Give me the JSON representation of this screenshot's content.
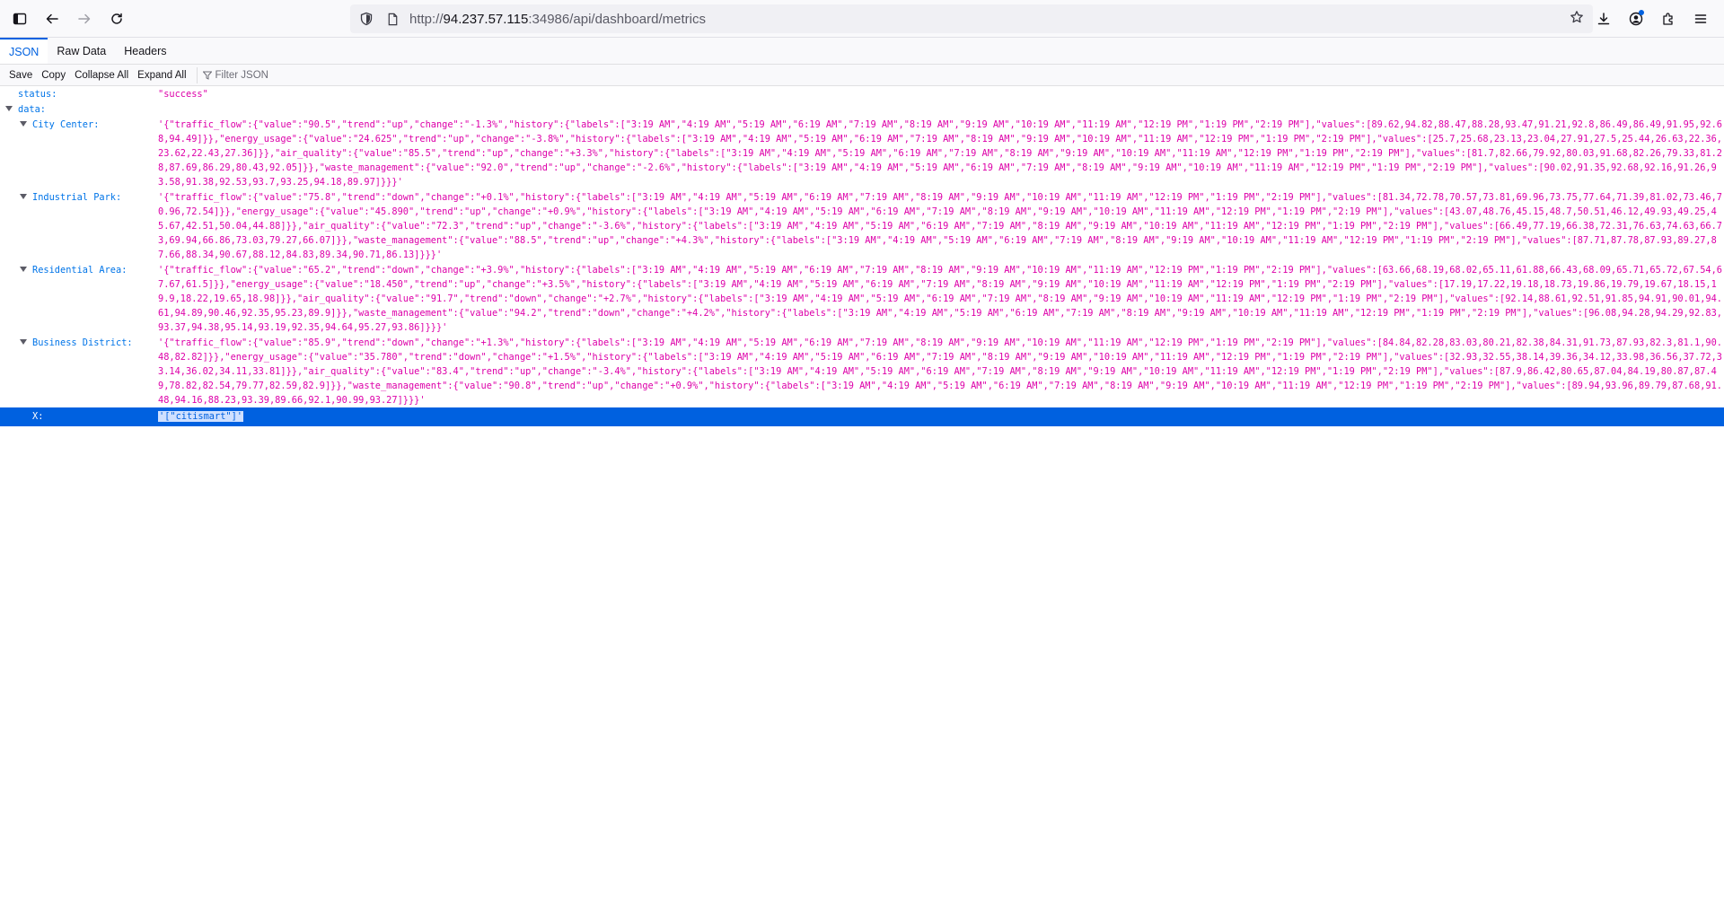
{
  "browser": {
    "url_scheme": "http://",
    "url_host": "94.237.57.115",
    "url_path": ":34986/api/dashboard/metrics"
  },
  "viewer": {
    "tabs": [
      "JSON",
      "Raw Data",
      "Headers"
    ],
    "actions": [
      "Save",
      "Copy",
      "Collapse All",
      "Expand All"
    ],
    "filter_placeholder": "Filter JSON"
  },
  "tree": {
    "status_key": "status:",
    "status_val": "\"success\"",
    "data_key": "data:",
    "entries": [
      {
        "key": "City Center:",
        "value": "'{\"traffic_flow\":{\"value\":\"90.5\",\"trend\":\"up\",\"change\":\"-1.3%\",\"history\":{\"labels\":[\"3:19 AM\",\"4:19 AM\",\"5:19 AM\",\"6:19 AM\",\"7:19 AM\",\"8:19 AM\",\"9:19 AM\",\"10:19 AM\",\"11:19 AM\",\"12:19 PM\",\"1:19 PM\",\"2:19 PM\"],\"values\":[89.62,94.82,88.47,88.28,93.47,91.21,92.8,86.49,86.49,91.95,92.68,94.49]}},\"energy_usage\":{\"value\":\"24.625\",\"trend\":\"up\",\"change\":\"-3.8%\",\"history\":{\"labels\":[\"3:19 AM\",\"4:19 AM\",\"5:19 AM\",\"6:19 AM\",\"7:19 AM\",\"8:19 AM\",\"9:19 AM\",\"10:19 AM\",\"11:19 AM\",\"12:19 PM\",\"1:19 PM\",\"2:19 PM\"],\"values\":[25.7,25.68,23.13,23.04,27.91,27.5,25.44,26.63,22.36,23.62,22.43,27.36]}},\"air_quality\":{\"value\":\"85.5\",\"trend\":\"up\",\"change\":\"+3.3%\",\"history\":{\"labels\":[\"3:19 AM\",\"4:19 AM\",\"5:19 AM\",\"6:19 AM\",\"7:19 AM\",\"8:19 AM\",\"9:19 AM\",\"10:19 AM\",\"11:19 AM\",\"12:19 PM\",\"1:19 PM\",\"2:19 PM\"],\"values\":[81.7,82.66,79.92,80.03,91.68,82.26,79.33,81.28,87.69,86.29,80.43,92.05]}},\"waste_management\":{\"value\":\"92.0\",\"trend\":\"up\",\"change\":\"-2.6%\",\"history\":{\"labels\":[\"3:19 AM\",\"4:19 AM\",\"5:19 AM\",\"6:19 AM\",\"7:19 AM\",\"8:19 AM\",\"9:19 AM\",\"10:19 AM\",\"11:19 AM\",\"12:19 PM\",\"1:19 PM\",\"2:19 PM\"],\"values\":[90.02,91.35,92.68,92.16,91.26,93.58,91.38,92.53,93.7,93.25,94.18,89.97]}}}'"
      },
      {
        "key": "Industrial Park:",
        "value": "'{\"traffic_flow\":{\"value\":\"75.8\",\"trend\":\"down\",\"change\":\"+0.1%\",\"history\":{\"labels\":[\"3:19 AM\",\"4:19 AM\",\"5:19 AM\",\"6:19 AM\",\"7:19 AM\",\"8:19 AM\",\"9:19 AM\",\"10:19 AM\",\"11:19 AM\",\"12:19 PM\",\"1:19 PM\",\"2:19 PM\"],\"values\":[81.34,72.78,70.57,73.81,69.96,73.75,77.64,71.39,81.02,73.46,70.96,72.54]}},\"energy_usage\":{\"value\":\"45.890\",\"trend\":\"up\",\"change\":\"+0.9%\",\"history\":{\"labels\":[\"3:19 AM\",\"4:19 AM\",\"5:19 AM\",\"6:19 AM\",\"7:19 AM\",\"8:19 AM\",\"9:19 AM\",\"10:19 AM\",\"11:19 AM\",\"12:19 PM\",\"1:19 PM\",\"2:19 PM\"],\"values\":[43.07,48.76,45.15,48.7,50.51,46.12,49.93,49.25,45.67,42.51,50.04,44.88]}},\"air_quality\":{\"value\":\"72.3\",\"trend\":\"up\",\"change\":\"-3.6%\",\"history\":{\"labels\":[\"3:19 AM\",\"4:19 AM\",\"5:19 AM\",\"6:19 AM\",\"7:19 AM\",\"8:19 AM\",\"9:19 AM\",\"10:19 AM\",\"11:19 AM\",\"12:19 PM\",\"1:19 PM\",\"2:19 PM\"],\"values\":[66.49,77.19,66.38,72.31,76.63,74.63,66.73,69.94,66.86,73.03,79.27,66.07]}},\"waste_management\":{\"value\":\"88.5\",\"trend\":\"up\",\"change\":\"+4.3%\",\"history\":{\"labels\":[\"3:19 AM\",\"4:19 AM\",\"5:19 AM\",\"6:19 AM\",\"7:19 AM\",\"8:19 AM\",\"9:19 AM\",\"10:19 AM\",\"11:19 AM\",\"12:19 PM\",\"1:19 PM\",\"2:19 PM\"],\"values\":[87.71,87.78,87.93,89.27,87.66,88.34,90.67,88.12,84.83,89.34,90.71,86.13]}}}'"
      },
      {
        "key": "Residential Area:",
        "value": "'{\"traffic_flow\":{\"value\":\"65.2\",\"trend\":\"down\",\"change\":\"+3.9%\",\"history\":{\"labels\":[\"3:19 AM\",\"4:19 AM\",\"5:19 AM\",\"6:19 AM\",\"7:19 AM\",\"8:19 AM\",\"9:19 AM\",\"10:19 AM\",\"11:19 AM\",\"12:19 PM\",\"1:19 PM\",\"2:19 PM\"],\"values\":[63.66,68.19,68.02,65.11,61.88,66.43,68.09,65.71,65.72,67.54,67.67,61.5]}},\"energy_usage\":{\"value\":\"18.450\",\"trend\":\"up\",\"change\":\"+3.5%\",\"history\":{\"labels\":[\"3:19 AM\",\"4:19 AM\",\"5:19 AM\",\"6:19 AM\",\"7:19 AM\",\"8:19 AM\",\"9:19 AM\",\"10:19 AM\",\"11:19 AM\",\"12:19 PM\",\"1:19 PM\",\"2:19 PM\"],\"values\":[17.19,17.22,19.18,18.73,19.86,19.79,19.67,18.15,19.9,18.22,19.65,18.98]}},\"air_quality\":{\"value\":\"91.7\",\"trend\":\"down\",\"change\":\"+2.7%\",\"history\":{\"labels\":[\"3:19 AM\",\"4:19 AM\",\"5:19 AM\",\"6:19 AM\",\"7:19 AM\",\"8:19 AM\",\"9:19 AM\",\"10:19 AM\",\"11:19 AM\",\"12:19 PM\",\"1:19 PM\",\"2:19 PM\"],\"values\":[92.14,88.61,92.51,91.85,94.91,90.01,94.61,94.89,90.46,92.35,95.23,89.9]}},\"waste_management\":{\"value\":\"94.2\",\"trend\":\"down\",\"change\":\"+4.2%\",\"history\":{\"labels\":[\"3:19 AM\",\"4:19 AM\",\"5:19 AM\",\"6:19 AM\",\"7:19 AM\",\"8:19 AM\",\"9:19 AM\",\"10:19 AM\",\"11:19 AM\",\"12:19 PM\",\"1:19 PM\",\"2:19 PM\"],\"values\":[96.08,94.28,94.29,92.83,93.37,94.38,95.14,93.19,92.35,94.64,95.27,93.86]}}}'"
      },
      {
        "key": "Business District:",
        "value": "'{\"traffic_flow\":{\"value\":\"85.9\",\"trend\":\"down\",\"change\":\"+1.3%\",\"history\":{\"labels\":[\"3:19 AM\",\"4:19 AM\",\"5:19 AM\",\"6:19 AM\",\"7:19 AM\",\"8:19 AM\",\"9:19 AM\",\"10:19 AM\",\"11:19 AM\",\"12:19 PM\",\"1:19 PM\",\"2:19 PM\"],\"values\":[84.84,82.28,83.03,80.21,82.38,84.31,91.73,87.93,82.3,81.1,90.48,82.82]}},\"energy_usage\":{\"value\":\"35.780\",\"trend\":\"down\",\"change\":\"+1.5%\",\"history\":{\"labels\":[\"3:19 AM\",\"4:19 AM\",\"5:19 AM\",\"6:19 AM\",\"7:19 AM\",\"8:19 AM\",\"9:19 AM\",\"10:19 AM\",\"11:19 AM\",\"12:19 PM\",\"1:19 PM\",\"2:19 PM\"],\"values\":[32.93,32.55,38.14,39.36,34.12,33.98,36.56,37.72,33.14,36.02,34.11,33.81]}},\"air_quality\":{\"value\":\"83.4\",\"trend\":\"up\",\"change\":\"-3.4%\",\"history\":{\"labels\":[\"3:19 AM\",\"4:19 AM\",\"5:19 AM\",\"6:19 AM\",\"7:19 AM\",\"8:19 AM\",\"9:19 AM\",\"10:19 AM\",\"11:19 AM\",\"12:19 PM\",\"1:19 PM\",\"2:19 PM\"],\"values\":[87.9,86.42,80.65,87.04,84.19,80.87,87.49,78.82,82.54,79.77,82.59,82.9]}},\"waste_management\":{\"value\":\"90.8\",\"trend\":\"up\",\"change\":\"+0.9%\",\"history\":{\"labels\":[\"3:19 AM\",\"4:19 AM\",\"5:19 AM\",\"6:19 AM\",\"7:19 AM\",\"8:19 AM\",\"9:19 AM\",\"10:19 AM\",\"11:19 AM\",\"12:19 PM\",\"1:19 PM\",\"2:19 PM\"],\"values\":[89.94,93.96,89.79,87.68,91.48,94.16,88.23,93.39,89.66,92.1,90.99,93.27]}}}'"
      }
    ],
    "x_key": "X:",
    "x_val": "'[\"citismart\"]'"
  },
  "colors": {
    "key": "#0074e8",
    "string": "#dd00a9",
    "selection": "#0061e0"
  },
  "icons": [
    "sidebar-icon",
    "back-icon",
    "forward-icon",
    "reload-icon",
    "shield-icon",
    "page-icon",
    "star-icon",
    "download-icon",
    "account-icon",
    "extensions-icon",
    "menu-icon",
    "filter-icon"
  ]
}
